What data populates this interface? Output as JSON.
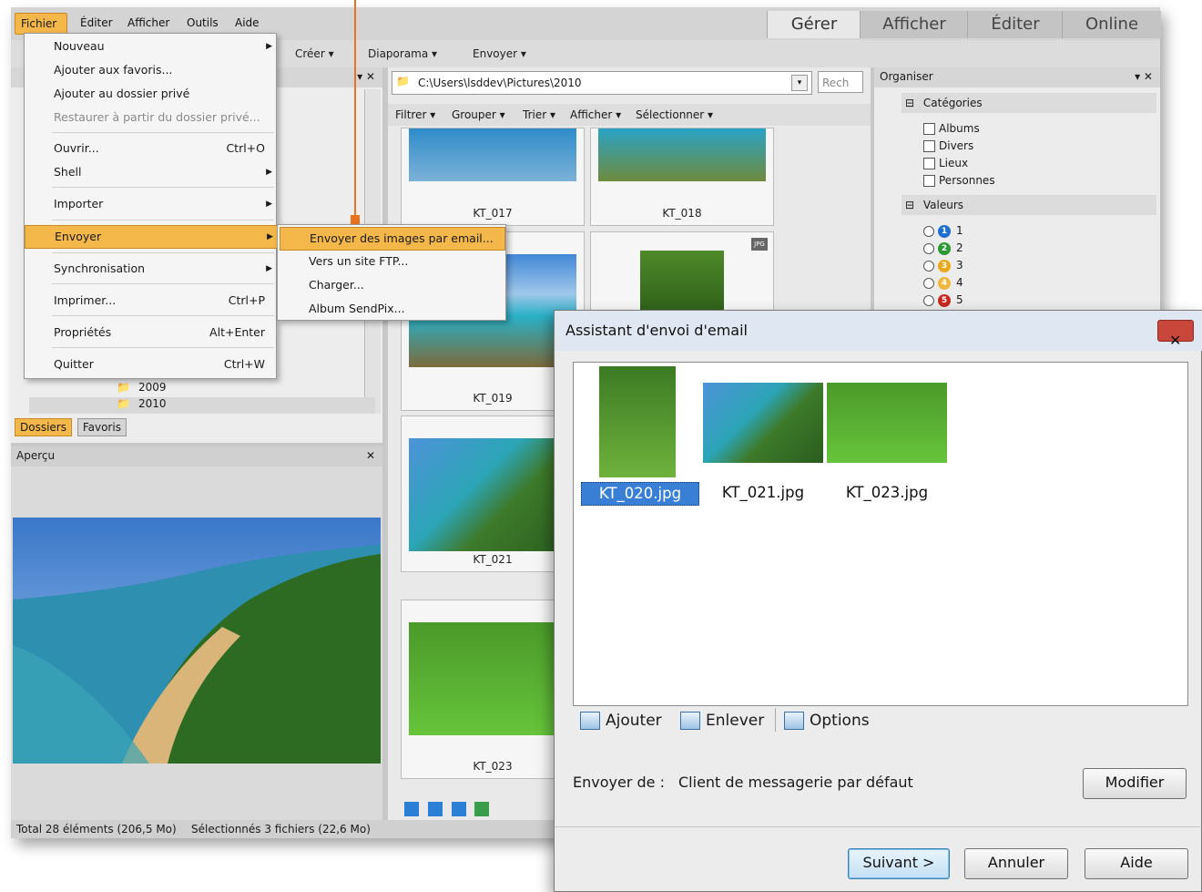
{
  "menubar": {
    "items": [
      "Fichier",
      "Éditer",
      "Afficher",
      "Outils",
      "Aide"
    ],
    "modes": [
      "Gérer",
      "Afficher",
      "Éditer",
      "Online"
    ]
  },
  "toolbar": {
    "create": "Créer",
    "slideshow": "Diaporama",
    "send": "Envoyer"
  },
  "fichier_menu": {
    "items": [
      {
        "label": "Nouveau",
        "shortcut": ""
      },
      {
        "label": "Ajouter aux favoris...",
        "shortcut": ""
      },
      {
        "label": "Ajouter au dossier privé",
        "shortcut": ""
      },
      {
        "label": "Restaurer à partir du dossier privé...",
        "shortcut": ""
      },
      {
        "label": "Ouvrir...",
        "shortcut": "Ctrl+O"
      },
      {
        "label": "Shell",
        "shortcut": ""
      },
      {
        "label": "Importer",
        "shortcut": ""
      },
      {
        "label": "Envoyer",
        "shortcut": ""
      },
      {
        "label": "Synchronisation",
        "shortcut": ""
      },
      {
        "label": "Imprimer...",
        "shortcut": "Ctrl+P"
      },
      {
        "label": "Propriétés",
        "shortcut": "Alt+Enter"
      },
      {
        "label": "Quitter",
        "shortcut": "Ctrl+W"
      }
    ]
  },
  "send_submenu": {
    "items": [
      "Envoyer des images par email...",
      "Vers un site FTP...",
      "Charger...",
      "Album SendPix..."
    ]
  },
  "folders": {
    "tree": [
      "2009",
      "2010"
    ],
    "tabs": [
      "Dossiers",
      "Favoris"
    ]
  },
  "preview": {
    "title": "Aperçu"
  },
  "browser": {
    "path": "C:\\Users\\lsddev\\Pictures\\2010",
    "search": "Rech",
    "filters": [
      "Filtrer",
      "Grouper",
      "Trier",
      "Afficher",
      "Sélectionner"
    ],
    "thumbs": [
      "KT_017",
      "KT_018",
      "KT_019",
      "KT_021",
      "KT_023"
    ],
    "jpg_badge": "JPG"
  },
  "organize": {
    "title": "Organiser",
    "categories_title": "Catégories",
    "categories": [
      "Albums",
      "Divers",
      "Lieux",
      "Personnes"
    ],
    "values_title": "Valeurs",
    "values": [
      "1",
      "2",
      "3",
      "4",
      "5"
    ]
  },
  "status": {
    "total": "Total 28 éléments  (206,5 Mo)",
    "selected": "Sélectionnés 3 fichiers (22,6 Mo)"
  },
  "dialog": {
    "title": "Assistant d'envoi d'email",
    "files": [
      "KT_020.jpg",
      "KT_021.jpg",
      "KT_023.jpg"
    ],
    "add": "Ajouter",
    "remove": "Enlever",
    "options": "Options",
    "send_from_label": "Envoyer de :",
    "send_from_value": "Client de messagerie par défaut",
    "modify": "Modifier",
    "next": "Suivant >",
    "cancel": "Annuler",
    "help": "Aide"
  },
  "colors": {
    "highlight": "#f3b74a",
    "selection": "#3a7fd6",
    "callout": "#e8741d"
  }
}
